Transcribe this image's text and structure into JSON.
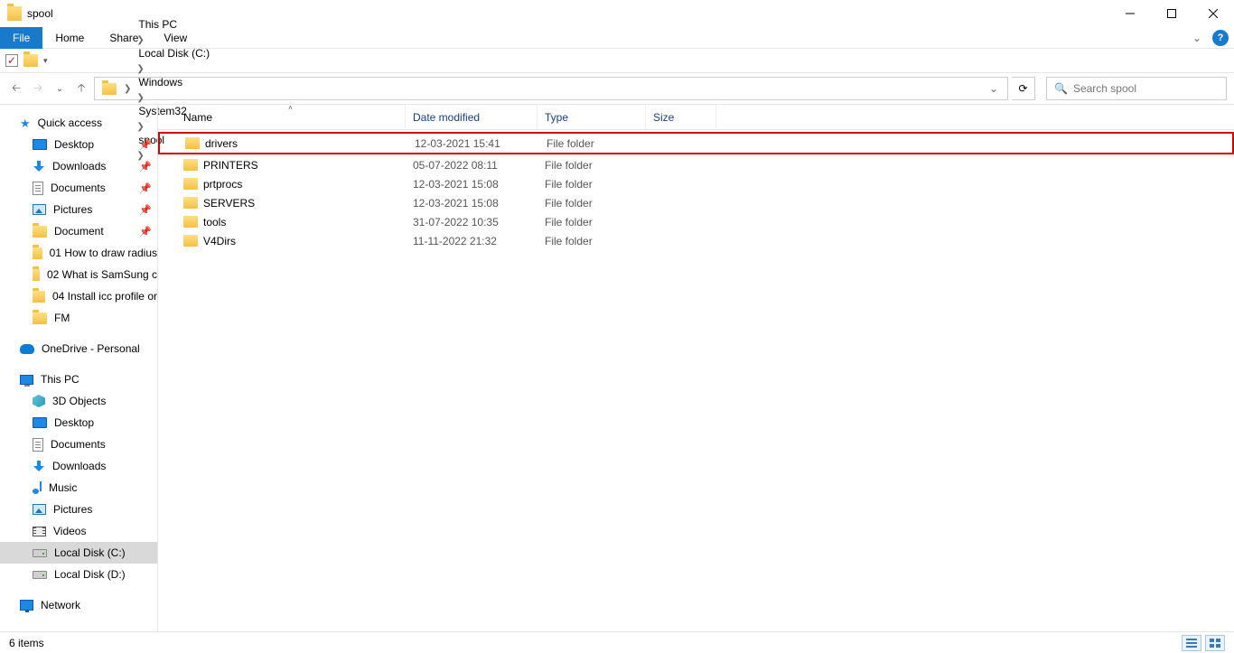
{
  "window": {
    "title": "spool"
  },
  "ribbon": {
    "file": "File",
    "tabs": [
      "Home",
      "Share",
      "View"
    ]
  },
  "breadcrumb": [
    "This PC",
    "Local Disk (C:)",
    "Windows",
    "System32",
    "spool"
  ],
  "search": {
    "placeholder": "Search spool"
  },
  "columns": {
    "name": "Name",
    "date": "Date modified",
    "type": "Type",
    "size": "Size"
  },
  "files": [
    {
      "name": "drivers",
      "date": "12-03-2021 15:41",
      "type": "File folder",
      "highlight": true
    },
    {
      "name": "PRINTERS",
      "date": "05-07-2022 08:11",
      "type": "File folder"
    },
    {
      "name": "prtprocs",
      "date": "12-03-2021 15:08",
      "type": "File folder"
    },
    {
      "name": "SERVERS",
      "date": "12-03-2021 15:08",
      "type": "File folder"
    },
    {
      "name": "tools",
      "date": "31-07-2022 10:35",
      "type": "File folder"
    },
    {
      "name": "V4Dirs",
      "date": "11-11-2022 21:32",
      "type": "File folder"
    }
  ],
  "sidebar": {
    "quick_access": "Quick access",
    "quick_items": [
      {
        "label": "Desktop",
        "icon": "desktop",
        "pin": true
      },
      {
        "label": "Downloads",
        "icon": "down",
        "pin": true
      },
      {
        "label": "Documents",
        "icon": "doc",
        "pin": true
      },
      {
        "label": "Pictures",
        "icon": "pic",
        "pin": true
      },
      {
        "label": "Document",
        "icon": "folder",
        "pin": true
      },
      {
        "label": "01 How to draw radius",
        "icon": "folder"
      },
      {
        "label": "02 What is SamSung c",
        "icon": "folder"
      },
      {
        "label": "04 Install icc profile or",
        "icon": "folder"
      },
      {
        "label": "FM",
        "icon": "folder"
      }
    ],
    "onedrive": "OneDrive - Personal",
    "this_pc": "This PC",
    "pc_items": [
      {
        "label": "3D Objects",
        "icon": "3d"
      },
      {
        "label": "Desktop",
        "icon": "desktop"
      },
      {
        "label": "Documents",
        "icon": "doc"
      },
      {
        "label": "Downloads",
        "icon": "down"
      },
      {
        "label": "Music",
        "icon": "music"
      },
      {
        "label": "Pictures",
        "icon": "pic"
      },
      {
        "label": "Videos",
        "icon": "video"
      },
      {
        "label": "Local Disk (C:)",
        "icon": "drive",
        "selected": true
      },
      {
        "label": "Local Disk (D:)",
        "icon": "drive"
      }
    ],
    "network": "Network"
  },
  "status": {
    "count": "6 items"
  }
}
